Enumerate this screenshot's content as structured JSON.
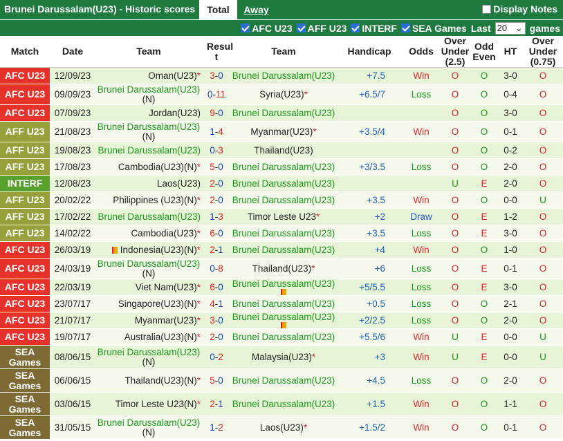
{
  "header": {
    "title": "Brunei Darussalam(U23) - Historic scores",
    "tab_total": "Total",
    "tab_away": "Away",
    "display_notes": "Display Notes"
  },
  "filters": {
    "items": [
      "AFC U23",
      "AFF U23",
      "INTERF",
      "SEA Games"
    ],
    "last_label": "Last",
    "last_value": "20",
    "games_label": "games"
  },
  "columns": [
    "Match",
    "Date",
    "Team",
    "Resul t",
    "Team",
    "Handicap",
    "Odds",
    "Over Under (2.5)",
    "Odd Even",
    "HT",
    "Over Under (0.75)"
  ],
  "colors": {
    "afc": "#e6322b",
    "aff": "#97a03a",
    "interf": "#5aa02e",
    "sea": "#7e6a35",
    "header_green": "#1e7a3e"
  },
  "rows": [
    {
      "league": "AFC U23",
      "date": "12/09/23",
      "home": "Oman(U23)",
      "home_star": true,
      "home_green": false,
      "home_n": false,
      "score": "3-0",
      "away": "Brunei Darussalam(U23)",
      "away_star": false,
      "away_green": true,
      "wl": "L",
      "handicap": "+7.5",
      "odds": "Win",
      "ou": "O",
      "oe": "O",
      "ht": "3-0",
      "ou2": "O"
    },
    {
      "league": "AFC U23",
      "date": "09/09/23",
      "home": "Brunei Darussalam(U23)",
      "home_star": false,
      "home_green": true,
      "home_n": true,
      "score": "0-11",
      "away": "Syria(U23)",
      "away_star": true,
      "away_green": false,
      "wl": "L",
      "handicap": "+6.5/7",
      "odds": "Loss",
      "ou": "O",
      "oe": "O",
      "ht": "0-4",
      "ou2": "O"
    },
    {
      "league": "AFC U23",
      "date": "07/09/23",
      "home": "Jordan(U23)",
      "home_star": false,
      "home_green": false,
      "home_n": false,
      "score": "9-0",
      "away": "Brunei Darussalam(U23)",
      "away_star": false,
      "away_green": true,
      "wl": "L",
      "handicap": "",
      "odds": "",
      "ou": "O",
      "oe": "O",
      "ht": "3-0",
      "ou2": "O"
    },
    {
      "league": "AFF U23",
      "date": "21/08/23",
      "home": "Brunei Darussalam(U23)",
      "home_star": false,
      "home_green": true,
      "home_n": true,
      "score": "1-4",
      "away": "Myanmar(U23)",
      "away_star": true,
      "away_green": false,
      "wl": "L",
      "handicap": "+3.5/4",
      "odds": "Win",
      "ou": "O",
      "oe": "O",
      "ht": "0-1",
      "ou2": "O"
    },
    {
      "league": "AFF U23",
      "date": "19/08/23",
      "home": "Brunei Darussalam(U23)",
      "home_star": false,
      "home_green": true,
      "home_n": false,
      "score": "0-3",
      "away": "Thailand(U23)",
      "away_star": false,
      "away_green": false,
      "wl": "L",
      "handicap": "",
      "odds": "",
      "ou": "O",
      "oe": "O",
      "ht": "0-2",
      "ou2": "O"
    },
    {
      "league": "AFF U23",
      "date": "17/08/23",
      "home": "Cambodia(U23)(N)",
      "home_star": true,
      "home_green": false,
      "home_n": false,
      "score": "5-0",
      "away": "Brunei Darussalam(U23)",
      "away_star": false,
      "away_green": true,
      "wl": "L",
      "handicap": "+3/3.5",
      "odds": "Loss",
      "ou": "O",
      "oe": "O",
      "ht": "2-0",
      "ou2": "O"
    },
    {
      "league": "INTERF",
      "date": "12/08/23",
      "home": "Laos(U23)",
      "home_star": false,
      "home_green": false,
      "home_n": false,
      "score": "2-0",
      "away": "Brunei Darussalam(U23)",
      "away_star": false,
      "away_green": true,
      "wl": "L",
      "handicap": "",
      "odds": "",
      "ou": "U",
      "oe": "E",
      "ht": "2-0",
      "ou2": "O"
    },
    {
      "league": "AFF U23",
      "date": "20/02/22",
      "home": "Philippines (U23)(N)",
      "home_star": true,
      "home_green": false,
      "home_n": false,
      "score": "2-0",
      "away": "Brunei Darussalam(U23)",
      "away_star": false,
      "away_green": true,
      "wl": "L",
      "handicap": "+3.5",
      "odds": "Win",
      "ou": "O",
      "oe": "O",
      "ht": "0-0",
      "ou2": "U"
    },
    {
      "league": "AFF U23",
      "date": "17/02/22",
      "home": "Brunei Darussalam(U23)",
      "home_star": false,
      "home_green": true,
      "home_n": false,
      "score": "1-3",
      "away": "Timor Leste U23",
      "away_star": true,
      "away_green": false,
      "wl": "L",
      "handicap": "+2",
      "odds": "Draw",
      "ou": "O",
      "oe": "E",
      "ht": "1-2",
      "ou2": "O"
    },
    {
      "league": "AFF U23",
      "date": "14/02/22",
      "home": "Cambodia(U23)",
      "home_star": true,
      "home_green": false,
      "home_n": false,
      "score": "6-0",
      "away": "Brunei Darussalam(U23)",
      "away_star": false,
      "away_green": true,
      "wl": "L",
      "handicap": "+3.5",
      "odds": "Loss",
      "ou": "O",
      "oe": "E",
      "ht": "3-0",
      "ou2": "O"
    },
    {
      "league": "AFC U23",
      "date": "26/03/19",
      "home": "Indonesia(U23)(N)",
      "home_star": true,
      "home_green": false,
      "home_n": false,
      "home_flag": true,
      "score": "2-1",
      "away": "Brunei Darussalam(U23)",
      "away_star": false,
      "away_green": true,
      "wl": "L",
      "handicap": "+4",
      "odds": "Win",
      "ou": "O",
      "oe": "O",
      "ht": "1-0",
      "ou2": "O"
    },
    {
      "league": "AFC U23",
      "date": "24/03/19",
      "home": "Brunei Darussalam(U23)",
      "home_star": false,
      "home_green": true,
      "home_n": true,
      "score": "0-8",
      "away": "Thailand(U23)",
      "away_star": true,
      "away_green": false,
      "wl": "L",
      "handicap": "+6",
      "odds": "Loss",
      "ou": "O",
      "oe": "E",
      "ht": "0-1",
      "ou2": "O"
    },
    {
      "league": "AFC U23",
      "date": "22/03/19",
      "home": "Viet Nam(U23)",
      "home_star": true,
      "home_green": false,
      "home_n": false,
      "score": "6-0",
      "away": "Brunei Darussalam(U23)",
      "away_star": false,
      "away_green": true,
      "away_flag": true,
      "wl": "L",
      "handicap": "+5/5.5",
      "odds": "Loss",
      "ou": "O",
      "oe": "E",
      "ht": "3-0",
      "ou2": "O"
    },
    {
      "league": "AFC U23",
      "date": "23/07/17",
      "home": "Singapore(U23)(N)",
      "home_star": true,
      "home_green": false,
      "home_n": false,
      "score": "4-1",
      "away": "Brunei Darussalam(U23)",
      "away_star": false,
      "away_green": true,
      "wl": "L",
      "handicap": "+0.5",
      "odds": "Loss",
      "ou": "O",
      "oe": "O",
      "ht": "2-1",
      "ou2": "O"
    },
    {
      "league": "AFC U23",
      "date": "21/07/17",
      "home": "Myanmar(U23)",
      "home_star": true,
      "home_green": false,
      "home_n": false,
      "score": "3-0",
      "away": "Brunei Darussalam(U23)",
      "away_star": false,
      "away_green": true,
      "away_flag": true,
      "wl": "L",
      "handicap": "+2/2.5",
      "odds": "Loss",
      "ou": "O",
      "oe": "O",
      "ht": "2-0",
      "ou2": "O"
    },
    {
      "league": "AFC U23",
      "date": "19/07/17",
      "home": "Australia(U23)(N)",
      "home_star": true,
      "home_green": false,
      "home_n": false,
      "score": "2-0",
      "away": "Brunei Darussalam(U23)",
      "away_star": false,
      "away_green": true,
      "wl": "L",
      "handicap": "+5.5/6",
      "odds": "Win",
      "ou": "U",
      "oe": "E",
      "ht": "0-0",
      "ou2": "U"
    },
    {
      "league": "SEA Games",
      "date": "08/06/15",
      "home": "Brunei Darussalam(U23)",
      "home_star": false,
      "home_green": true,
      "home_n": true,
      "score": "0-2",
      "away": "Malaysia(U23)",
      "away_star": true,
      "away_green": false,
      "wl": "L",
      "handicap": "+3",
      "odds": "Win",
      "ou": "U",
      "oe": "E",
      "ht": "0-0",
      "ou2": "U"
    },
    {
      "league": "SEA Games",
      "date": "06/06/15",
      "home": "Thailand(U23)(N)",
      "home_star": true,
      "home_green": false,
      "home_n": false,
      "score": "5-0",
      "away": "Brunei Darussalam(U23)",
      "away_star": false,
      "away_green": true,
      "wl": "L",
      "handicap": "+4.5",
      "odds": "Loss",
      "ou": "O",
      "oe": "O",
      "ht": "2-0",
      "ou2": "O"
    },
    {
      "league": "SEA Games",
      "date": "03/06/15",
      "home": "Timor Leste U23(N)",
      "home_star": true,
      "home_green": false,
      "home_n": false,
      "score": "2-1",
      "away": "Brunei Darussalam(U23)",
      "away_star": false,
      "away_green": true,
      "wl": "L",
      "handicap": "+1.5",
      "odds": "Win",
      "ou": "O",
      "oe": "O",
      "ht": "1-1",
      "ou2": "O"
    },
    {
      "league": "SEA Games",
      "date": "31/05/15",
      "home": "Brunei Darussalam(U23)",
      "home_star": false,
      "home_green": true,
      "home_n": true,
      "score": "1-2",
      "away": "Laos(U23)",
      "away_star": true,
      "away_green": false,
      "wl": "L",
      "handicap": "+1.5/2",
      "odds": "Win",
      "ou": "O",
      "oe": "O",
      "ht": "0-1",
      "ou2": "O"
    }
  ]
}
